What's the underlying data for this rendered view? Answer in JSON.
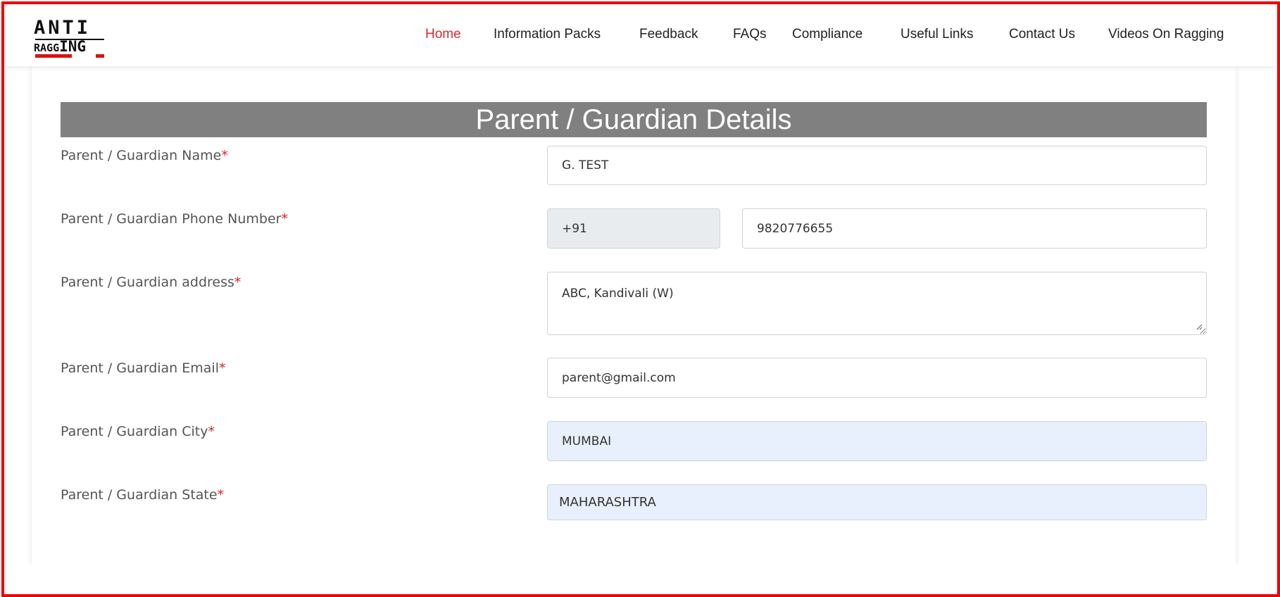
{
  "header": {
    "logo": {
      "top_text": "ANTI",
      "bottom_text_small": "RAGG",
      "bottom_text_large": "ING"
    },
    "nav": [
      {
        "label": "Home",
        "active": true
      },
      {
        "label": "Information Packs",
        "active": false
      },
      {
        "label": "Feedback",
        "active": false
      },
      {
        "label": "FAQs",
        "active": false
      },
      {
        "label": "Compliance",
        "active": false
      },
      {
        "label": "Useful Links",
        "active": false
      },
      {
        "label": "Contact Us",
        "active": false
      },
      {
        "label": "Videos On Ragging",
        "active": false
      }
    ]
  },
  "form": {
    "title": "Parent / Guardian Details",
    "required_marker": "*",
    "fields": {
      "name": {
        "label": "Parent / Guardian Name",
        "value": "G. TEST"
      },
      "phone": {
        "label": "Parent / Guardian Phone Number",
        "code": "+91",
        "value": "9820776655"
      },
      "address": {
        "label": "Parent / Guardian address",
        "value": "ABC, Kandivali (W)"
      },
      "email": {
        "label": "Parent / Guardian Email",
        "value": "parent@gmail.com"
      },
      "city": {
        "label": "Parent / Guardian City",
        "value": "MUMBAI"
      },
      "state": {
        "label": "Parent / Guardian State",
        "value": "MAHARASHTRA"
      }
    }
  },
  "colors": {
    "frame_border": "#ee0000",
    "nav_active": "#d92b2b",
    "title_bar": "#808080",
    "required": "#e02020",
    "autofill_bg": "#e8f0fe",
    "readonly_bg": "#e9ecef"
  }
}
